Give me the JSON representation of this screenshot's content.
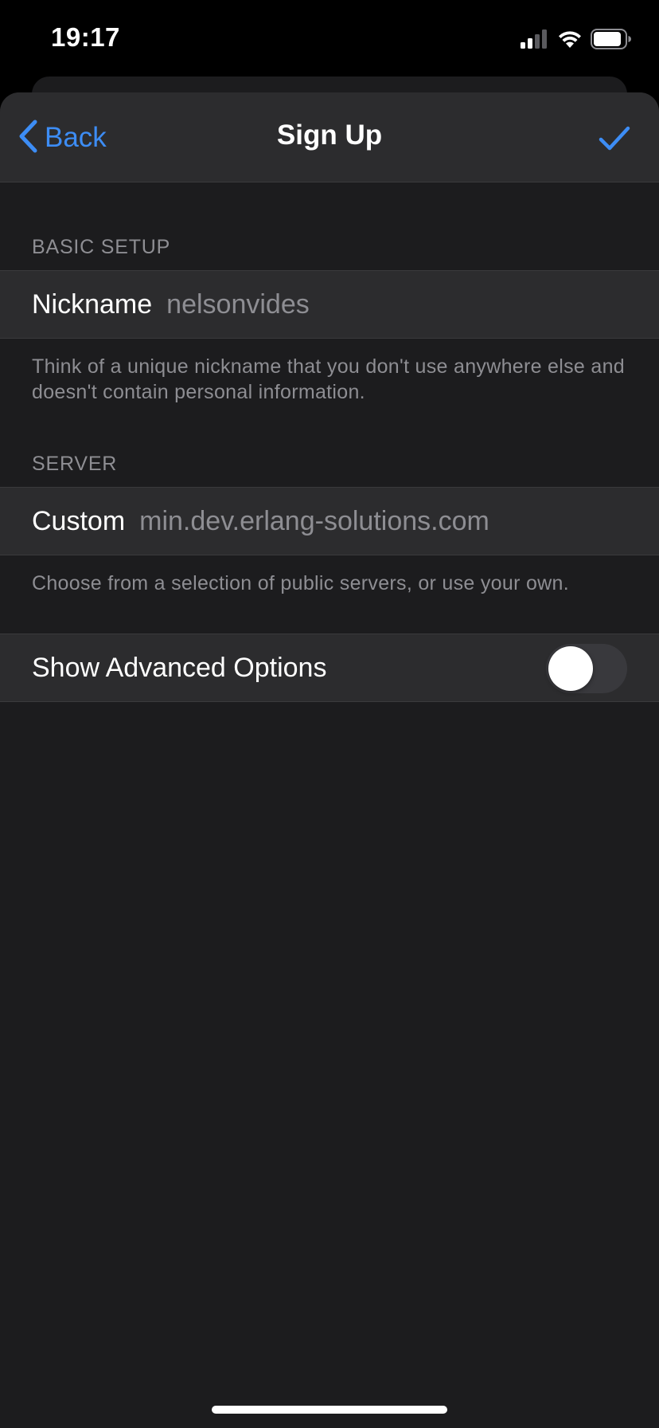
{
  "status_bar": {
    "time": "19:17",
    "icons": [
      "cellular-signal-icon",
      "wifi-icon",
      "battery-icon"
    ]
  },
  "nav": {
    "back_label": "Back",
    "title": "Sign Up",
    "done_icon": "checkmark-icon"
  },
  "basic_setup": {
    "header": "BASIC SETUP",
    "nickname_label": "Nickname",
    "nickname_value": "nelsonvides",
    "footer": "Think of a unique nickname that you don't use anywhere else and doesn't contain personal information."
  },
  "server": {
    "header": "SERVER",
    "custom_label": "Custom",
    "custom_value": "min.dev.erlang-solutions.com",
    "footer": "Choose from a selection of public servers, or use your own."
  },
  "advanced": {
    "label": "Show Advanced Options",
    "enabled": false
  },
  "colors": {
    "accent": "#3d8df5",
    "background": "#1c1c1e",
    "cell": "#2c2c2e",
    "secondary_text": "#8e8e93"
  }
}
